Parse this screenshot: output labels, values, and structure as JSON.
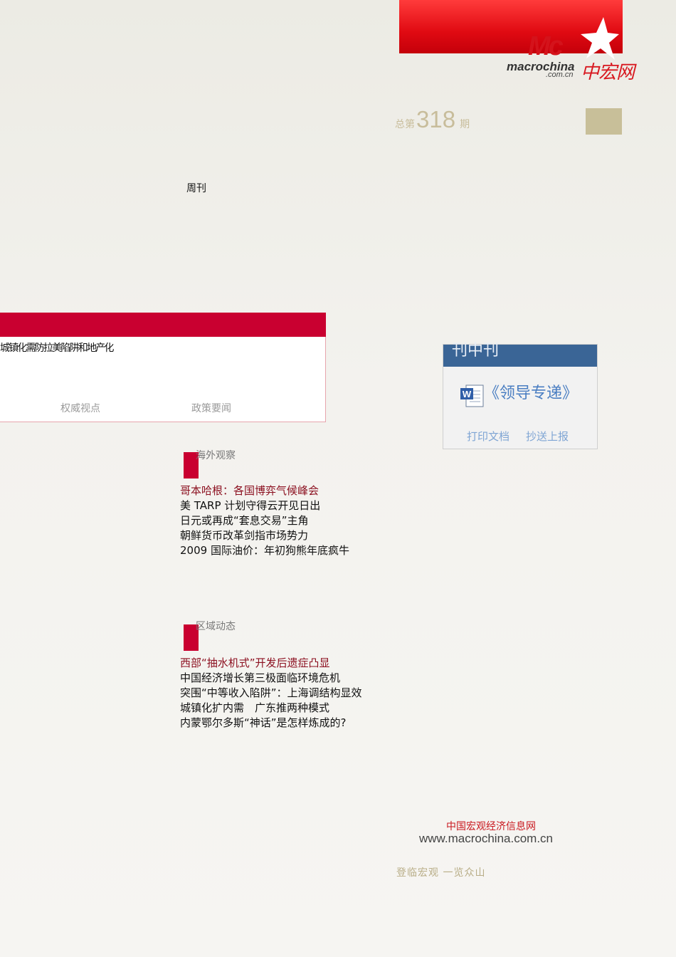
{
  "logo": {
    "mark": "Mc",
    "site": "macrochina",
    "domain": ".com.cn",
    "name_cn": "中宏网",
    "accent": "#d4131b"
  },
  "issue": {
    "prefix": "总第",
    "number": "318",
    "suffix": "期"
  },
  "weekly_label": "周刊",
  "headline": {
    "text": "城镇化需防拉美陷阱和地产化",
    "tabs": [
      "权威视点",
      "政策要闻"
    ]
  },
  "widget": {
    "title": "刊中刊",
    "doc_title": "《领导专递》",
    "links": [
      "打印文档",
      "抄送上报"
    ]
  },
  "sections": [
    {
      "title": "海外观察",
      "items": [
        "哥本哈根：各国博弈气候峰会",
        "美 TARP 计划守得云开见日出",
        "日元或再成“套息交易”主角",
        "朝鲜货币改革剑指市场势力",
        "2009 国际油价：年初狗熊年底疯牛"
      ]
    },
    {
      "title": "区域动态",
      "items": [
        "西部“抽水机式”开发后遗症凸显",
        "中国经济增长第三极面临环境危机",
        "突围“中等收入陷阱”：上海调结构显效",
        "城镇化扩内需　广东推两种模式",
        "内蒙鄂尔多斯“神话”是怎样炼成的?"
      ]
    }
  ],
  "footer": {
    "org": "中国宏观经济信息网",
    "url": "www.macrochina.com.cn",
    "slogan": "登临宏观 一览众山"
  },
  "colors": {
    "brand_red": "#c90030",
    "widget_blue": "#3a6596",
    "gold": "#c8bd9b"
  }
}
